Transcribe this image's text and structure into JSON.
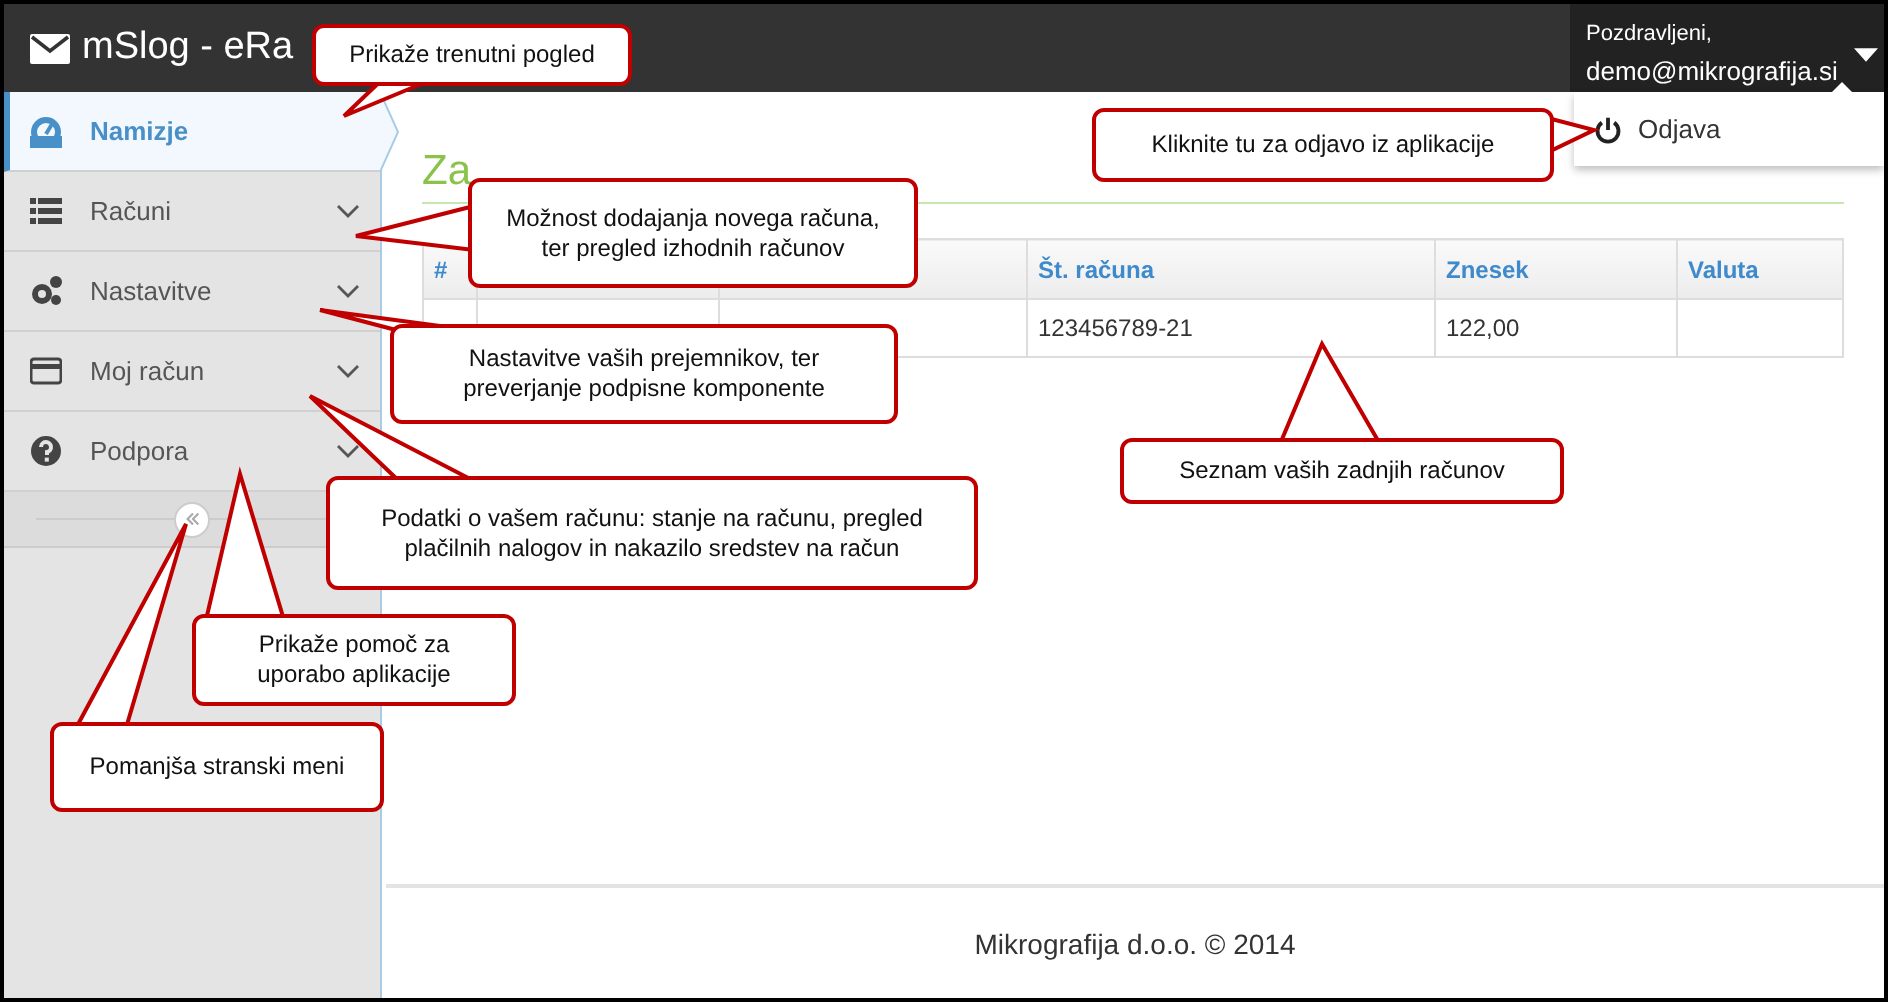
{
  "app": {
    "title": "mSlog - eRa"
  },
  "user": {
    "greeting": "Pozdravljeni,",
    "email": "demo@mikrografija.si"
  },
  "user_menu": [
    {
      "label": "Odjava",
      "kind": "logout"
    }
  ],
  "sidebar": {
    "items": [
      {
        "label": "Namizje",
        "kind": "dashboard",
        "selected": true,
        "expandable": false
      },
      {
        "label": "Računi",
        "kind": "list",
        "selected": false,
        "expandable": true
      },
      {
        "label": "Nastavitve",
        "kind": "gears",
        "selected": false,
        "expandable": true
      },
      {
        "label": "Moj račun",
        "kind": "card",
        "selected": false,
        "expandable": true
      },
      {
        "label": "Podpora",
        "kind": "help",
        "selected": false,
        "expandable": true
      }
    ]
  },
  "main": {
    "heading": "Za"
  },
  "table": {
    "columns": [
      {
        "label": "#"
      },
      {},
      {},
      {
        "label": "Št. računa"
      },
      {
        "label": "Znesek"
      },
      {
        "label": "Valuta"
      }
    ],
    "rows": [
      {
        "cells": [
          {},
          {},
          {},
          {
            "text": "123456789-21"
          },
          {
            "text": "122,00"
          },
          {}
        ]
      }
    ]
  },
  "footer": {
    "text": "Mikrografija d.o.o. © 2014"
  },
  "callouts": [
    {
      "text": "Prikaže trenutni pogled"
    },
    {
      "text": "Možnost dodajanja novega računa, ter pregled izhodnih računov"
    },
    {
      "text": "Nastavitve vaših prejemnikov, ter preverjanje podpisne komponente"
    },
    {
      "text": "Podatki o vašem računu: stanje na računu, pregled plačilnih nalogov in nakazilo sredstev na račun"
    },
    {
      "text": "Kliknite tu za odjavo iz aplikacije"
    },
    {
      "text": "Seznam vaših zadnjih računov"
    },
    {
      "text": "Prikaže pomoč za uporabo aplikacije"
    },
    {
      "text": "Pomanjša stranski meni"
    }
  ]
}
